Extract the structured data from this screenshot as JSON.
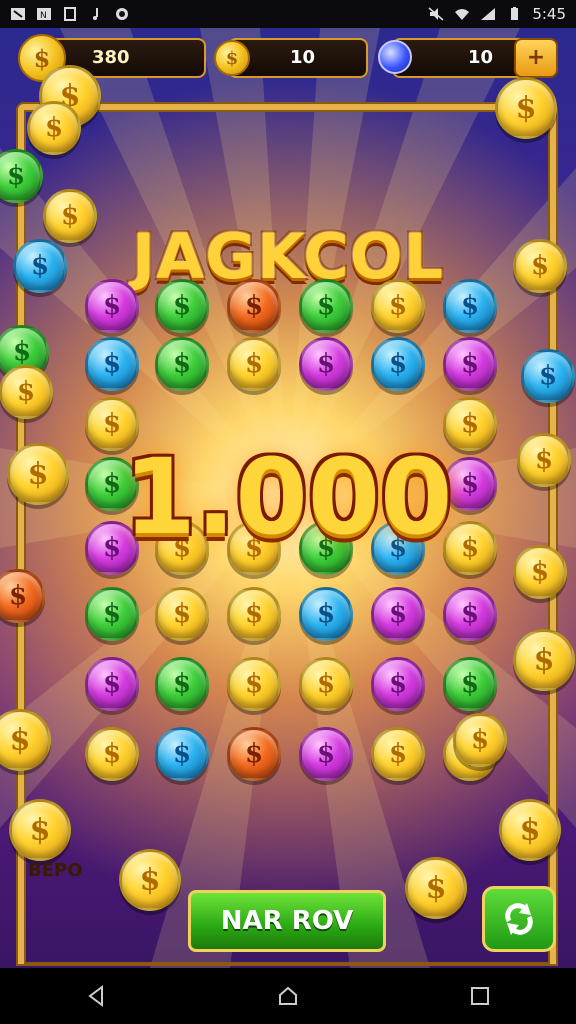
{
  "status_bar": {
    "time": "5:45",
    "left_icons": [
      "notification-icon",
      "notification-icon",
      "notification-icon",
      "music-icon",
      "sync-icon"
    ],
    "right_icons": [
      "mute-icon",
      "wifi-icon",
      "signal-icon",
      "battery-icon"
    ]
  },
  "hud": {
    "coins_value": "380",
    "gold_value": "10",
    "gems_value": "10",
    "plus_label": "+"
  },
  "game": {
    "title": "JAGKCOL",
    "jackpot_amount": "1.000",
    "coin_symbol": "$",
    "side_label": "BEPO",
    "action_button": "NAR ROV"
  },
  "navbar": {
    "back": "back-icon",
    "home": "home-icon",
    "recents": "recents-icon"
  }
}
